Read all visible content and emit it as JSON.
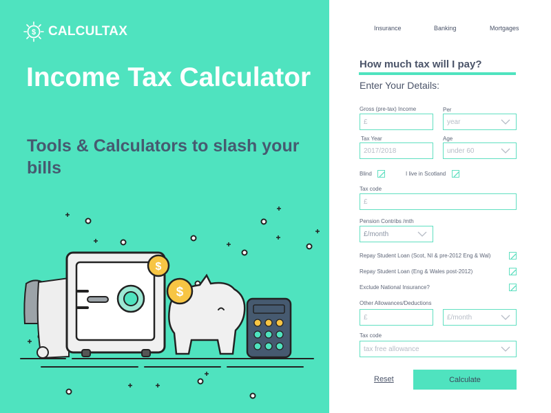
{
  "brand": {
    "name": "CALCULTAX"
  },
  "hero": {
    "title": "Income Tax Calculator",
    "subtitle": "Tools & Calculators to slash your bills"
  },
  "nav": {
    "items": [
      "Insurance",
      "Banking",
      "Mortgages"
    ]
  },
  "form": {
    "title": "How much tax will I pay?",
    "subtitle": "Enter Your Details:",
    "gross_label": "Gross (pre-tax) Income",
    "gross_placeholder": "£",
    "per_label": "Per",
    "per_value": "year",
    "tax_year_label": "Tax Year",
    "tax_year_value": "2017/2018",
    "age_label": "Age",
    "age_value": "under 60",
    "blind_label": "Blind",
    "blind_checked": true,
    "scotland_label": "I live in Scotland",
    "scotland_checked": true,
    "tax_code_label": "Tax code",
    "tax_code_placeholder": "£",
    "pension_label": "Pension Contribs /mth",
    "pension_value": "£/month",
    "student_loan_1_label": "Repay Student Loan (Scot, NI & pre-2012 Eng & Wal)",
    "student_loan_1_checked": true,
    "student_loan_2_label": "Repay Student Loan (Eng & Wales post-2012)",
    "student_loan_2_checked": true,
    "exclude_ni_label": "Exclude National Insurance?",
    "exclude_ni_checked": true,
    "allowances_label": "Other Allowances/Deductions",
    "allowances_placeholder": "£",
    "allowances_period_value": "£/month",
    "tax_code_2_label": "Tax code",
    "tax_code_2_value": "tax free allowance",
    "reset_label": "Reset",
    "calculate_label": "Calculate"
  },
  "colors": {
    "accent": "#4fe3bf",
    "text_dark": "#4a5368",
    "subtitle": "#465a70"
  },
  "icons": [
    "dollar-sun-logo-icon",
    "chevron-down-icon",
    "checkmark-icon",
    "safe-icon",
    "piggy-bank-icon",
    "coin-icon",
    "calculator-icon"
  ]
}
